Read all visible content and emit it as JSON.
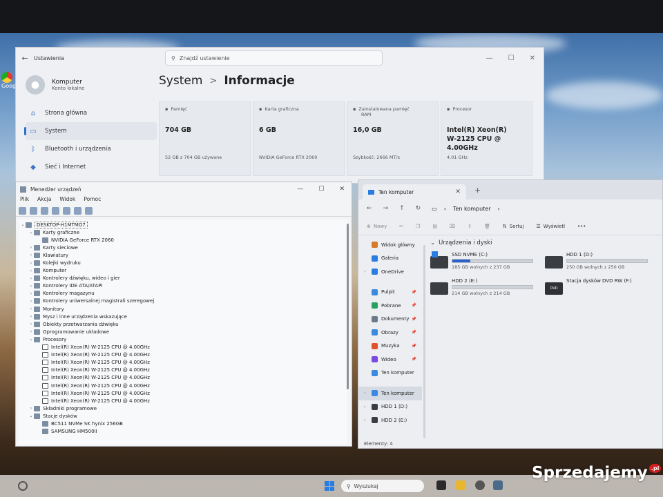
{
  "settings": {
    "app_title": "Ustawienia",
    "search_placeholder": "Znajdź ustawienie",
    "user": {
      "name": "Komputer",
      "subtitle": "Konto lokalne"
    },
    "nav": [
      {
        "label": "Strona główna",
        "icon": "home-icon"
      },
      {
        "label": "System",
        "icon": "monitor-icon",
        "active": true
      },
      {
        "label": "Bluetooth i urządzenia",
        "icon": "bluetooth-icon"
      },
      {
        "label": "Sieć i Internet",
        "icon": "wifi-icon"
      }
    ],
    "breadcrumb_parent": "System",
    "breadcrumb_separator": ">",
    "page_title": "Informacje",
    "cards": [
      {
        "label": "Pamięć",
        "sub": "",
        "value": "704 GB",
        "footer": "52 GB z 704 GB używane"
      },
      {
        "label": "Karta graficzna",
        "sub": "",
        "value": "6 GB",
        "footer": "NVIDIA GeForce RTX 2060"
      },
      {
        "label": "Zainstalowana pamięć",
        "sub": "RAM",
        "value": "16,0 GB",
        "footer": "Szybkość: 2666 MT/s"
      },
      {
        "label": "Procesor",
        "sub": "",
        "value": "Intel(R) Xeon(R) W-2125 CPU @ 4.00GHz",
        "footer": "4.01 GHz"
      }
    ]
  },
  "device_manager": {
    "title": "Menedżer urządzeń",
    "menu": [
      "Plik",
      "Akcja",
      "Widok",
      "Pomoc"
    ],
    "rows": [
      {
        "level": 0,
        "expander": "v",
        "label": "DESKTOP-H1MTMO7",
        "root": true
      },
      {
        "level": 1,
        "expander": "v",
        "label": "Karty graficzne"
      },
      {
        "level": 2,
        "expander": "",
        "label": "NVIDIA GeForce RTX 2060"
      },
      {
        "level": 1,
        "expander": ">",
        "label": "Karty sieciowe"
      },
      {
        "level": 1,
        "expander": ">",
        "label": "Klawiatury"
      },
      {
        "level": 1,
        "expander": ">",
        "label": "Kolejki wydruku"
      },
      {
        "level": 1,
        "expander": ">",
        "label": "Komputer"
      },
      {
        "level": 1,
        "expander": ">",
        "label": "Kontrolery dźwięku, wideo i gier"
      },
      {
        "level": 1,
        "expander": ">",
        "label": "Kontrolery IDE ATA/ATAPI"
      },
      {
        "level": 1,
        "expander": ">",
        "label": "Kontrolery magazynu"
      },
      {
        "level": 1,
        "expander": ">",
        "label": "Kontrolery uniwersalnej magistrali szeregowej"
      },
      {
        "level": 1,
        "expander": ">",
        "label": "Monitory"
      },
      {
        "level": 1,
        "expander": ">",
        "label": "Mysz i inne urządzenia wskazujące"
      },
      {
        "level": 1,
        "expander": ">",
        "label": "Obiekty przetwarzania dźwięku"
      },
      {
        "level": 1,
        "expander": ">",
        "label": "Oprogramowanie układowe"
      },
      {
        "level": 1,
        "expander": "v",
        "label": "Procesory"
      },
      {
        "level": 2,
        "expander": "",
        "label": "Intel(R) Xeon(R) W-2125 CPU @ 4.00GHz",
        "cpu": true
      },
      {
        "level": 2,
        "expander": "",
        "label": "Intel(R) Xeon(R) W-2125 CPU @ 4.00GHz",
        "cpu": true
      },
      {
        "level": 2,
        "expander": "",
        "label": "Intel(R) Xeon(R) W-2125 CPU @ 4.00GHz",
        "cpu": true
      },
      {
        "level": 2,
        "expander": "",
        "label": "Intel(R) Xeon(R) W-2125 CPU @ 4.00GHz",
        "cpu": true
      },
      {
        "level": 2,
        "expander": "",
        "label": "Intel(R) Xeon(R) W-2125 CPU @ 4.00GHz",
        "cpu": true
      },
      {
        "level": 2,
        "expander": "",
        "label": "Intel(R) Xeon(R) W-2125 CPU @ 4.00GHz",
        "cpu": true
      },
      {
        "level": 2,
        "expander": "",
        "label": "Intel(R) Xeon(R) W-2125 CPU @ 4.00GHz",
        "cpu": true
      },
      {
        "level": 2,
        "expander": "",
        "label": "Intel(R) Xeon(R) W-2125 CPU @ 4.00GHz",
        "cpu": true
      },
      {
        "level": 1,
        "expander": ">",
        "label": "Składniki programowe"
      },
      {
        "level": 1,
        "expander": "v",
        "label": "Stacje dysków"
      },
      {
        "level": 2,
        "expander": "",
        "label": "BC511 NVMe SK hynix 256GB"
      },
      {
        "level": 2,
        "expander": "",
        "label": "SAMSUNG HM500II"
      }
    ]
  },
  "explorer": {
    "tab_title": "Ten komputer",
    "address": "Ten komputer",
    "commands": {
      "new": "Nowy",
      "sort": "Sortuj",
      "view": "Wyświetl",
      "more": "•••"
    },
    "nav": [
      {
        "label": "Widok główny",
        "icon_color": "#d77a2a",
        "pinned": false,
        "chevron": ""
      },
      {
        "label": "Galeria",
        "icon_color": "#2a7de1",
        "pinned": false,
        "chevron": ""
      },
      {
        "label": "OneDrive",
        "icon_color": "#2a7de1",
        "pinned": false,
        "chevron": ">"
      },
      {
        "sep": true
      },
      {
        "label": "Pulpit",
        "icon_color": "#3a8ae0",
        "pinned": true,
        "chevron": ""
      },
      {
        "label": "Pobrane",
        "icon_color": "#2aa060",
        "pinned": true,
        "chevron": ""
      },
      {
        "label": "Dokumenty",
        "icon_color": "#6d7a8c",
        "pinned": true,
        "chevron": ""
      },
      {
        "label": "Obrazy",
        "icon_color": "#3a8ae0",
        "pinned": true,
        "chevron": ""
      },
      {
        "label": "Muzyka",
        "icon_color": "#e0522a",
        "pinned": true,
        "chevron": ""
      },
      {
        "label": "Wideo",
        "icon_color": "#7a4ae0",
        "pinned": true,
        "chevron": ""
      },
      {
        "label": "Ten komputer",
        "icon_color": "#3a8ae0",
        "pinned": false,
        "chevron": ""
      },
      {
        "sep": true
      },
      {
        "label": "Ten komputer",
        "icon_color": "#3a8ae0",
        "pinned": false,
        "chevron": ">",
        "active": true
      },
      {
        "label": "HDD 1 (D:)",
        "icon_color": "#3a3d42",
        "pinned": false,
        "chevron": ">"
      },
      {
        "label": "HDD 2 (E:)",
        "icon_color": "#3a3d42",
        "pinned": false,
        "chevron": ">"
      }
    ],
    "group_title": "Urządzenia i dyski",
    "drives": [
      {
        "name": "SSD NVME (C:)",
        "free": "185 GB wolnych z 237 GB",
        "used_fraction": 0.22,
        "type": "win"
      },
      {
        "name": "HDD 1 (D:)",
        "free": "250 GB wolnych z 250 GB",
        "used_fraction": 0.0,
        "type": "hdd"
      },
      {
        "name": "HDD 2 (E:)",
        "free": "214 GB wolnych z 214 GB",
        "used_fraction": 0.0,
        "type": "hdd"
      },
      {
        "name": "Stacja dysków DVD RW (F:)",
        "free": "",
        "used_fraction": null,
        "type": "dvd",
        "icon_text": "DVD"
      }
    ],
    "status": "Elementy: 4"
  },
  "taskbar": {
    "search_label": "Wyszukaj"
  },
  "watermark": {
    "text": "Sprzedajemy",
    "badge": ".pl"
  },
  "desktop": {
    "icon_label": "Googl"
  }
}
